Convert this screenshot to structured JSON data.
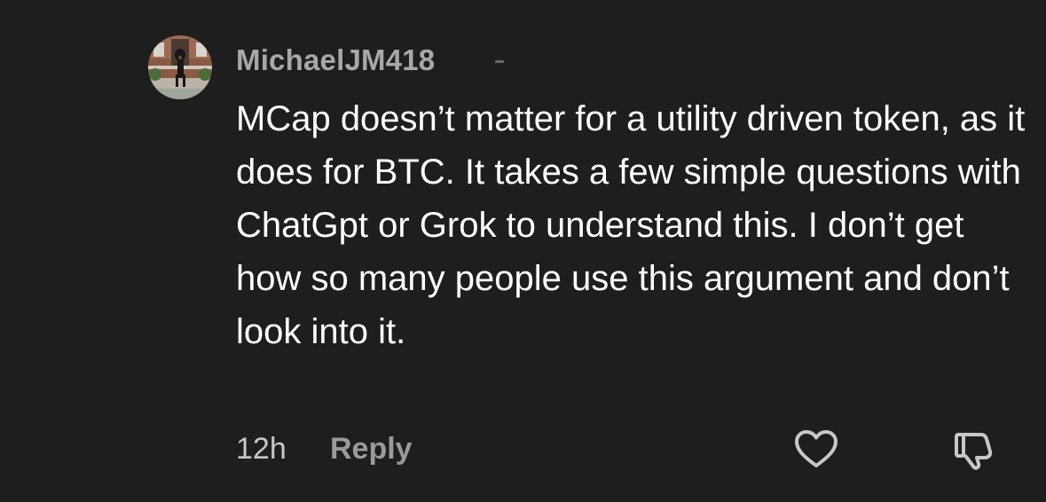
{
  "comment": {
    "username": "MichaelJM418",
    "text": "MCap doesn’t matter for a utility driven token, as it does for BTC. It takes a few simple questions with ChatGpt or Grok to understand this. I don’t get how so many people use this argument and don’t look into it.",
    "timestamp": "12h",
    "reply_label": "Reply",
    "like_icon": "heart-outline-icon",
    "dislike_icon": "thumbs-down-outline-icon"
  },
  "colors": {
    "background": "#1e1e1e",
    "username": "#a8a8a8",
    "text": "#ffffff",
    "reply": "#9a9a9a",
    "icon": "#c8c8c8"
  }
}
